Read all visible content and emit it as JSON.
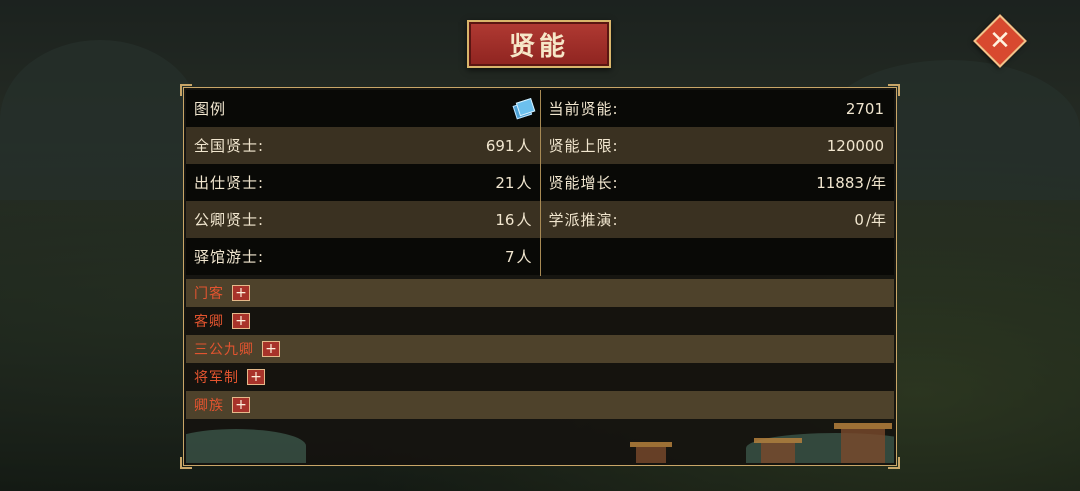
{
  "title": "贤能",
  "close_icon": "close-icon",
  "legend": {
    "label": "图例",
    "icon": "book-icon"
  },
  "left_stats": [
    {
      "label": "全国贤士:",
      "value": "691",
      "unit": "人"
    },
    {
      "label": "出仕贤士:",
      "value": "21",
      "unit": "人"
    },
    {
      "label": "公卿贤士:",
      "value": "16",
      "unit": "人"
    },
    {
      "label": "驿馆游士:",
      "value": "7",
      "unit": "人"
    }
  ],
  "right_stats": [
    {
      "label": "当前贤能:",
      "value": "2701",
      "unit": ""
    },
    {
      "label": "贤能上限:",
      "value": "120000",
      "unit": ""
    },
    {
      "label": "贤能增长:",
      "value": "11883",
      "unit": "/年"
    },
    {
      "label": "学派推演:",
      "value": "0",
      "unit": "/年"
    }
  ],
  "categories": [
    {
      "name": "门客",
      "button": "+"
    },
    {
      "name": "客卿",
      "button": "+"
    },
    {
      "name": "三公九卿",
      "button": "+"
    },
    {
      "name": "将军制",
      "button": "+"
    },
    {
      "name": "卿族",
      "button": "+"
    }
  ],
  "colors": {
    "accent_red": "#e2542f",
    "frame_gold": "#c9a668",
    "text": "#f1e6cf"
  }
}
